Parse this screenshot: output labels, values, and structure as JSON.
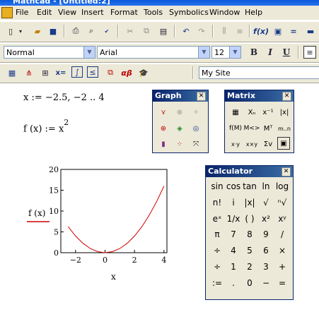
{
  "window": {
    "title": "Mathcad - [Untitled:2]"
  },
  "menu": [
    "File",
    "Edit",
    "View",
    "Insert",
    "Format",
    "Tools",
    "Symbolics",
    "Window",
    "Help"
  ],
  "format_toolbar": {
    "style": "Normal",
    "font": "Arial",
    "size": "12",
    "bold": "B",
    "italic": "I",
    "underline": "U"
  },
  "math_toolbar": {
    "resource": "My Site"
  },
  "worksheet": {
    "range_def": "x := −2.5, −2 .. 4",
    "func_def_lhs": "f (x) := x",
    "func_def_exp": "2"
  },
  "chart_data": {
    "type": "line",
    "x": [
      -2.5,
      -2,
      -1.5,
      -1,
      -0.5,
      0,
      0.5,
      1,
      1.5,
      2,
      2.5,
      3,
      3.5,
      4
    ],
    "series": [
      {
        "values": [
          6.25,
          4,
          2.25,
          1,
          0.25,
          0,
          0.25,
          1,
          2.25,
          4,
          6.25,
          9,
          12.25,
          16
        ]
      }
    ],
    "xlabel": "x",
    "ylabel": "f (x)",
    "xticks": [
      "−2",
      "0",
      "2",
      "4"
    ],
    "yticks": [
      "0",
      "5",
      "10",
      "15",
      "20"
    ],
    "xlim": [
      -3,
      4.2
    ],
    "ylim": [
      0,
      20
    ],
    "line_color": "#cc0000"
  },
  "palettes": {
    "graph": {
      "title": "Graph"
    },
    "matrix": {
      "title": "Matrix"
    },
    "calculator": {
      "title": "Calculator",
      "rows": [
        [
          "sin",
          "cos",
          "tan",
          "ln",
          "log"
        ],
        [
          "n!",
          "i",
          "|x|",
          "√",
          "ⁿ√"
        ],
        [
          "eˣ",
          "1/x",
          "( )",
          "x²",
          "xʸ"
        ],
        [
          "π",
          "7",
          "8",
          "9",
          "/"
        ],
        [
          "÷",
          "4",
          "5",
          "6",
          "×"
        ],
        [
          "÷",
          "1",
          "2",
          "3",
          "+"
        ],
        [
          ":=",
          ".",
          "0",
          "−",
          "="
        ]
      ]
    }
  }
}
